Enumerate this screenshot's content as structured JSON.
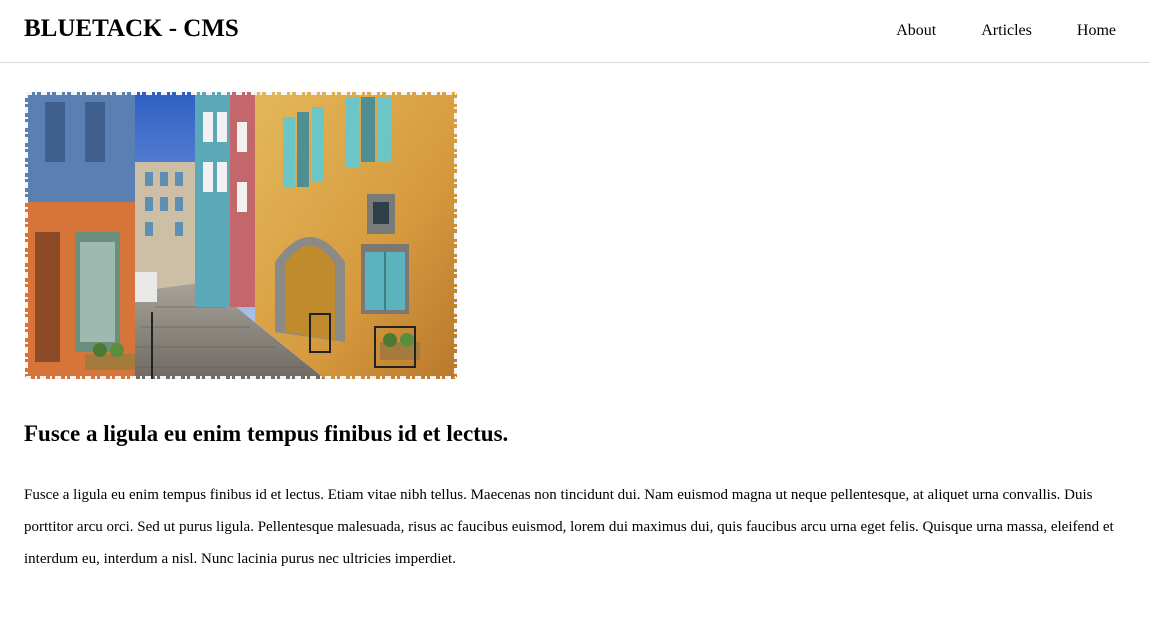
{
  "header": {
    "site_title": "BLUETACK - CMS",
    "nav": [
      {
        "label": "About"
      },
      {
        "label": "Articles"
      },
      {
        "label": "Home"
      }
    ]
  },
  "article": {
    "title": "Fusce a ligula eu enim tempus finibus id et lectus.",
    "body": "Fusce a ligula eu enim tempus finibus id et lectus. Etiam vitae nibh tellus. Maecenas non tincidunt dui. Nam euismod magna ut neque pellentesque, at aliquet urna convallis. Duis porttitor arcu orci. Sed ut purus ligula. Pellentesque malesuada, risus ac faucibus euismod, lorem dui maximus dui, quis faucibus arcu urna eget felis. Quisque urna massa, eleifend et interdum eu, interdum a nisl. Nunc lacinia purus nec ultricies imperdiet."
  },
  "colors": {
    "sky": "#3a6fd1",
    "wall_yellow": "#d9a64a",
    "wall_blue": "#5aa8b8",
    "wall_orange": "#d7743a",
    "shutter_teal": "#6cc6c8",
    "street_gray": "#8c8a86"
  }
}
